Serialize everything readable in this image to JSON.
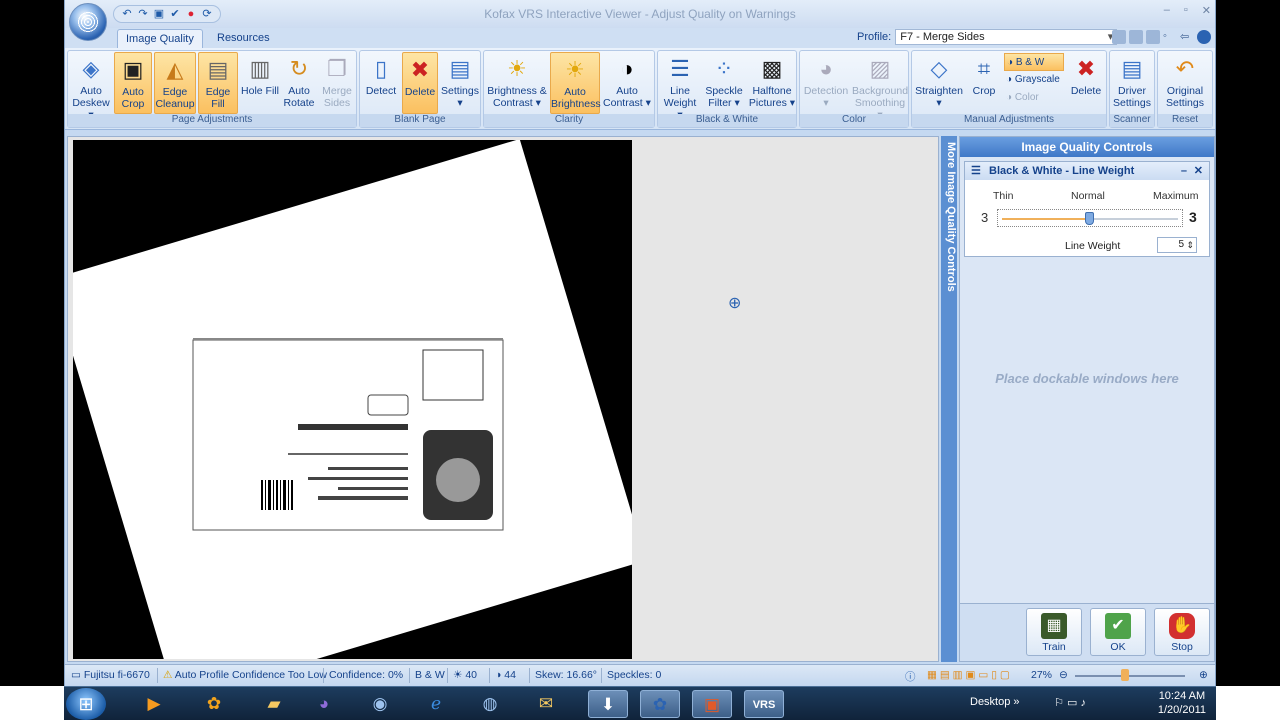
{
  "title": "Kofax VRS Interactive Viewer - Adjust Quality on Warnings",
  "tabs": [
    "Image Quality",
    "Resources"
  ],
  "profile": {
    "label": "Profile:",
    "value": "F7 - Merge Sides"
  },
  "ribbon": {
    "page_adjustments": {
      "label": "Page Adjustments",
      "buttons": [
        "Auto Deskew",
        "Auto Crop",
        "Edge Cleanup",
        "Edge Fill",
        "Hole Fill",
        "Auto Rotate",
        "Merge Sides"
      ]
    },
    "blank_page": {
      "label": "Blank Page",
      "buttons": [
        "Detect",
        "Delete",
        "Settings"
      ]
    },
    "clarity": {
      "label": "Clarity",
      "buttons": [
        "Brightness & Contrast",
        "Auto Brightness",
        "Auto Contrast"
      ]
    },
    "black_white": {
      "label": "Black & White",
      "buttons": [
        "Line Weight",
        "Speckle Filter",
        "Halftone Pictures"
      ]
    },
    "color": {
      "label": "Color",
      "buttons": [
        "Detection",
        "Background Smoothing"
      ]
    },
    "manual_adjustments": {
      "label": "Manual Adjustments",
      "buttons": [
        "Straighten",
        "Crop",
        "Delete"
      ],
      "modes": [
        "B & W",
        "Grayscale",
        "Color"
      ]
    },
    "scanner": {
      "label": "Scanner",
      "buttons": [
        "Driver Settings"
      ]
    },
    "reset": {
      "label": "Reset",
      "buttons": [
        "Original Settings"
      ]
    }
  },
  "dock_strip": "More Image Quality Controls",
  "panel": {
    "title": "Image Quality Controls",
    "bw": {
      "title": "Black & White - Line Weight",
      "labels": [
        "Thin",
        "Normal",
        "Maximum"
      ],
      "min_value": "3",
      "max_value": "3",
      "slider_fraction": 0.5,
      "field_label": "Line Weight",
      "field_value": "5"
    },
    "placeholder": "Place dockable windows here",
    "actions": [
      "Train",
      "OK",
      "Stop"
    ]
  },
  "status": {
    "scanner": "Fujitsu fi-6670",
    "warning": "Auto Profile Confidence Too Low",
    "confidence": "Confidence: 0%",
    "mode": "B & W",
    "brightness": "40",
    "contrast": "44",
    "skew": "Skew: 16.66°",
    "speckles": "Speckles: 0",
    "zoom": "27%"
  },
  "taskbar": {
    "desktop": "Desktop",
    "time": "10:24 AM",
    "date": "1/20/2011",
    "vrs": "VRS"
  },
  "colors": {
    "accent": "#15428b",
    "ribbon_active": "#fbc060",
    "panel_header": "#3f78c7"
  }
}
